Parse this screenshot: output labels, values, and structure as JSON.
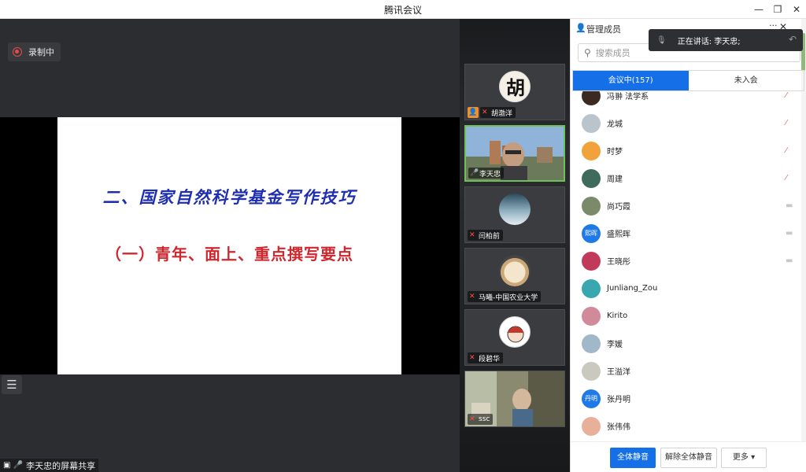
{
  "window": {
    "title": "腾讯会议",
    "min": "—",
    "restore": "❐",
    "close": "✕"
  },
  "stage": {
    "recording_label": "录制中",
    "slide": {
      "heading": "二、国家自然科学基金写作技巧",
      "subheading": "（一）青年、面上、重点撰写要点"
    },
    "list_icon": "☰",
    "share_label": "李天忠的屏幕共享"
  },
  "videos": [
    {
      "name": "胡渤洋",
      "mic": "muted",
      "host": true,
      "avatar_char": "胡"
    },
    {
      "name": "李天忠",
      "mic": "on",
      "active": true
    },
    {
      "name": "闫柏前",
      "mic": "muted"
    },
    {
      "name": "马曦-中国农业大学",
      "mic": "muted"
    },
    {
      "name": "段碧华",
      "mic": "muted"
    },
    {
      "name": "ssc",
      "mic": "muted"
    }
  ],
  "panel": {
    "title": "管理成员",
    "more": "···",
    "close": "✕",
    "speaking": "正在讲话: 李天忠;",
    "search_placeholder": "搜索成员",
    "tabs": [
      {
        "label": "会议中(157)",
        "active": true
      },
      {
        "label": "未入会",
        "active": false
      }
    ],
    "members": [
      {
        "name": "冯翀 法学系",
        "status": "muted",
        "color": "#3a2a20"
      },
      {
        "name": "龙城",
        "status": "muted",
        "color": "#b9c4cc"
      },
      {
        "name": "时梦",
        "status": "muted",
        "color": "#f2a23a"
      },
      {
        "name": "周建",
        "status": "muted",
        "color": "#3f6b5c"
      },
      {
        "name": "尚巧霞",
        "status": "camera-off",
        "color": "#7a8a6a"
      },
      {
        "name": "盛熙晖",
        "status": "camera-off",
        "color": "#1f7ae8",
        "initials": "熙晖"
      },
      {
        "name": "王晓彤",
        "status": "camera-off",
        "color": "#c23a5a"
      },
      {
        "name": "Junliang_Zou",
        "status": "",
        "color": "#38a7b0"
      },
      {
        "name": "Kirito",
        "status": "",
        "color": "#d08a9a"
      },
      {
        "name": "李媛",
        "status": "",
        "color": "#a0b8c8"
      },
      {
        "name": "王溢洋",
        "status": "",
        "color": "#c9c9c0"
      },
      {
        "name": "张丹明",
        "status": "",
        "color": "#1f7ae8",
        "initials": "丹明"
      },
      {
        "name": "张伟伟",
        "status": "",
        "color": "#e8b098"
      }
    ],
    "footer": {
      "mute_all": "全体静音",
      "unmute_all": "解除全体静音",
      "more": "更多 ▾"
    }
  }
}
